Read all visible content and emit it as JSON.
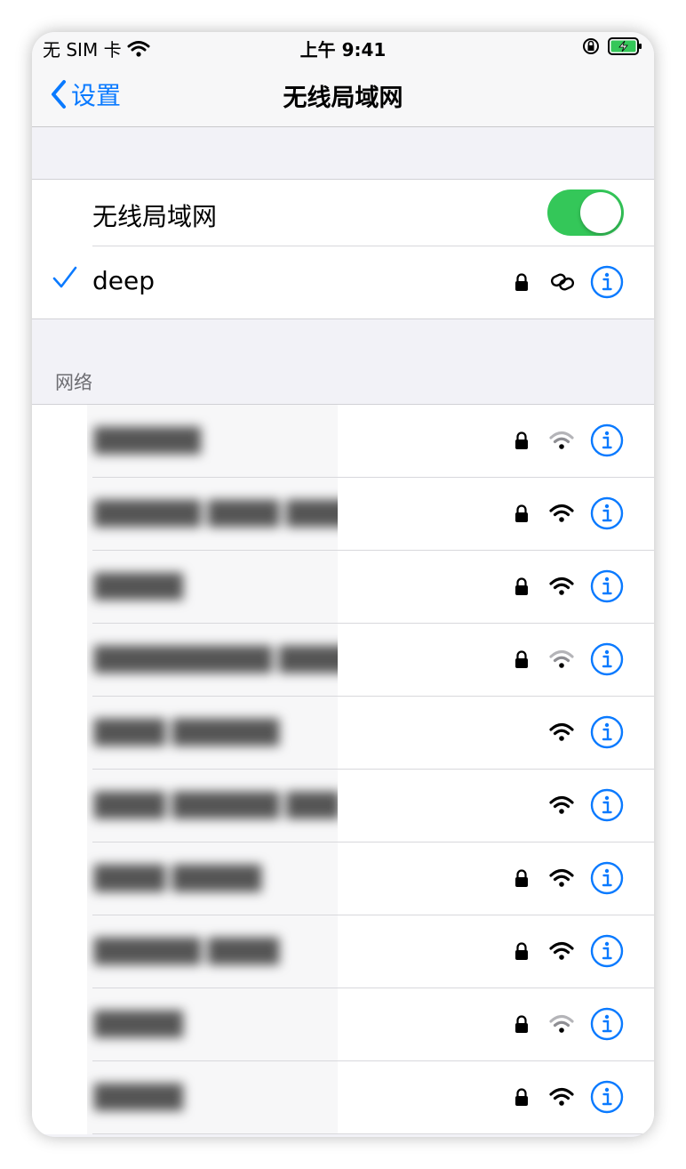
{
  "status": {
    "carrier": "无 SIM 卡",
    "time": "上午 9:41"
  },
  "nav": {
    "back_label": "设置",
    "title": "无线局域网"
  },
  "wifi_toggle": {
    "label": "无线局域网",
    "on": true
  },
  "connected": {
    "name": "deep",
    "secured": true
  },
  "networks_section_title": "网络",
  "networks": [
    {
      "name": "██████",
      "secured": true,
      "strong": false
    },
    {
      "name": "██████ ████ █████",
      "secured": true,
      "strong": true
    },
    {
      "name": "█████",
      "secured": true,
      "strong": true
    },
    {
      "name": "██████████ ██████ █████",
      "secured": true,
      "strong": false
    },
    {
      "name": "████ ██████",
      "secured": false,
      "strong": true
    },
    {
      "name": "████ ██████ ███",
      "secured": false,
      "strong": true
    },
    {
      "name": "████ █████",
      "secured": true,
      "strong": true
    },
    {
      "name": "██████ ████",
      "secured": true,
      "strong": true
    },
    {
      "name": "█████",
      "secured": true,
      "strong": false
    },
    {
      "name": "█████",
      "secured": true,
      "strong": true
    }
  ],
  "colors": {
    "accent": "#0a7aff",
    "toggle_on": "#34c759",
    "battery": "#34c759"
  }
}
